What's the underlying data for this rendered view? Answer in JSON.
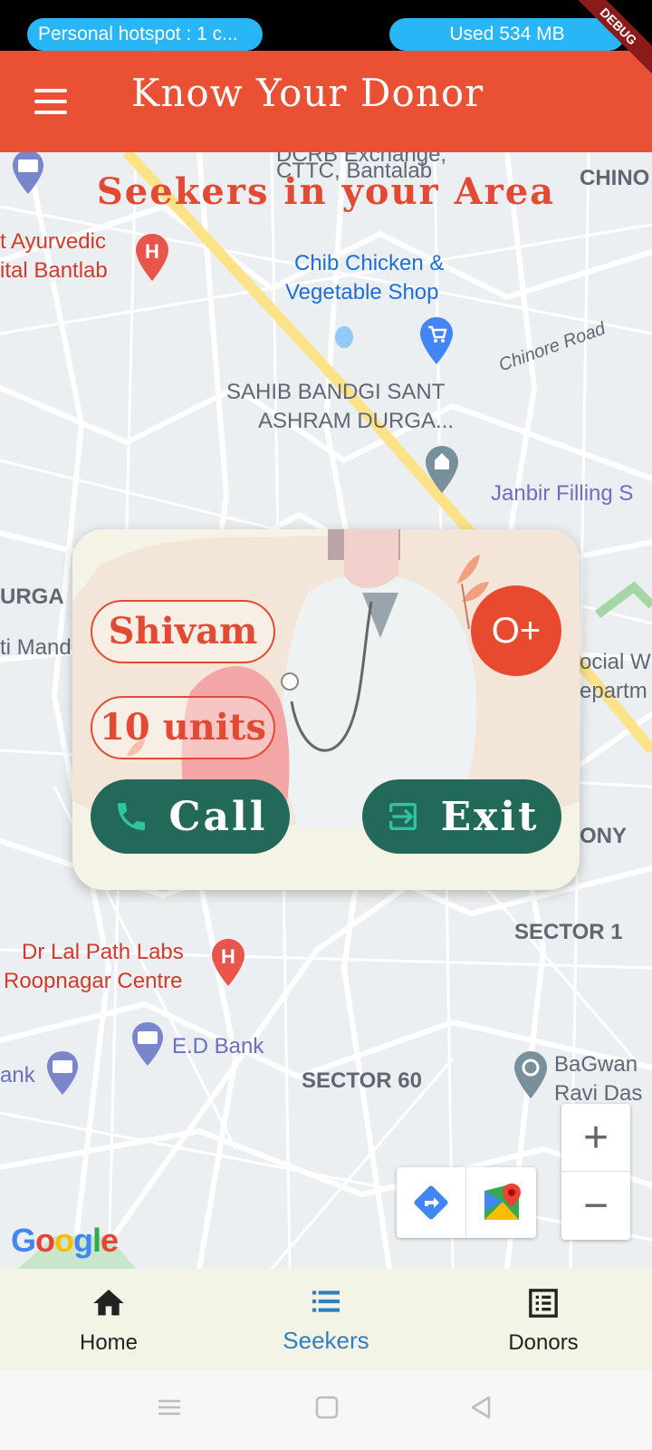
{
  "status_bar": {
    "hotspot_text": "Personal hotspot : 1 c...",
    "data_used": "Used  534 MB",
    "debug_label": "DEBUG"
  },
  "app_bar": {
    "title": "Know Your Donor",
    "menu_icon": "hamburger-menu-icon"
  },
  "map": {
    "heading": "Seekers in your Area",
    "labels": {
      "cttc": "CTTC, Bantalab",
      "cttc_top": "DCRB Exchange,",
      "chino": "CHINO",
      "ayurvedic_1": "t Ayurvedic",
      "ayurvedic_2": "ital Bantlab",
      "chib_1": "Chib Chicken &",
      "chib_2": "Vegetable Shop",
      "chinore_road": "Chinore Road",
      "sahib_1": "SAHIB BANDGI SANT",
      "sahib_2": "ASHRAM DURGA...",
      "janbir": "Janbir Filling S",
      "durga": "URGA",
      "mand": "ti Mand",
      "social_1": "ocial W",
      "social_2": "epartm",
      "colony": "ONY",
      "sector1": "SECTOR 1",
      "lal_1": "Dr Lal Path Labs",
      "lal_2": "Roopnagar Centre",
      "ed_bank": "E.D Bank",
      "ank": "ank",
      "sector60": "SECTOR 60",
      "bagwan_1": "BaGwan",
      "bagwan_2": "Ravi Das"
    },
    "zoom_in": "+",
    "zoom_out": "−",
    "google": [
      "G",
      "o",
      "o",
      "g",
      "l",
      "e"
    ]
  },
  "card": {
    "name": "Shivam",
    "units": "10 units",
    "blood_group": "O+",
    "call_label": "Call",
    "exit_label": "Exit"
  },
  "bottom_nav": {
    "items": [
      {
        "label": "Home",
        "icon": "home-icon"
      },
      {
        "label": "Seekers",
        "icon": "list-icon"
      },
      {
        "label": "Donors",
        "icon": "document-list-icon"
      }
    ]
  },
  "colors": {
    "app_bar": "#ea5034",
    "accent_red": "#e34a33",
    "button_green": "#22695a",
    "active_nav": "#2f7fc1",
    "status_pill": "#29b6f6"
  }
}
